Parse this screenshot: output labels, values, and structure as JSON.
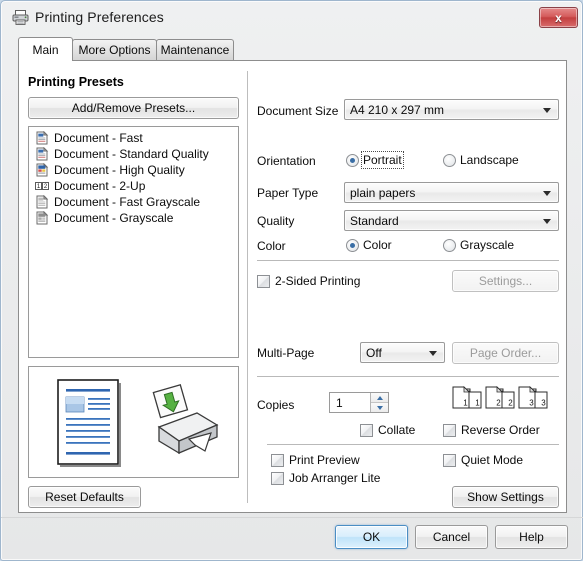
{
  "window": {
    "title": "Printing Preferences",
    "icon": "printer-icon",
    "close_label": "x"
  },
  "tabs": [
    {
      "label": "Main",
      "active": true
    },
    {
      "label": "More Options",
      "active": false
    },
    {
      "label": "Maintenance",
      "active": false
    }
  ],
  "presets": {
    "heading": "Printing Presets",
    "add_remove_label": "Add/Remove Presets...",
    "items": [
      {
        "label": "Document - Fast",
        "icon": "document-fast-icon"
      },
      {
        "label": "Document - Standard Quality",
        "icon": "document-standard-icon"
      },
      {
        "label": "Document - High Quality",
        "icon": "document-high-icon"
      },
      {
        "label": "Document - 2-Up",
        "icon": "document-2up-icon"
      },
      {
        "label": "Document - Fast Grayscale",
        "icon": "document-fast-grayscale-icon"
      },
      {
        "label": "Document - Grayscale",
        "icon": "document-grayscale-icon"
      }
    ]
  },
  "preview": {
    "document_icon": "document-page-preview-icon",
    "printer_icon": "printer-output-icon"
  },
  "settings": {
    "document_size": {
      "label": "Document Size",
      "value": "A4 210 x 297 mm"
    },
    "orientation": {
      "label": "Orientation",
      "portrait_label": "Portrait",
      "landscape_label": "Landscape",
      "selected": "Portrait"
    },
    "paper_type": {
      "label": "Paper Type",
      "value": "plain papers"
    },
    "quality": {
      "label": "Quality",
      "value": "Standard"
    },
    "color": {
      "label": "Color",
      "color_label": "Color",
      "grayscale_label": "Grayscale",
      "selected": "Color"
    },
    "two_sided": {
      "label": "2-Sided Printing",
      "checked": false,
      "settings_label": "Settings...",
      "settings_enabled": false
    },
    "multi_page": {
      "label": "Multi-Page",
      "value": "Off",
      "page_order_label": "Page Order...",
      "page_order_enabled": false
    },
    "copies": {
      "label": "Copies",
      "value": "1",
      "order_icons": [
        "1",
        "2",
        "3"
      ],
      "collate_label": "Collate",
      "collate_checked": false,
      "reverse_order_label": "Reverse Order",
      "reverse_order_checked": false
    },
    "print_preview": {
      "label": "Print Preview",
      "checked": false
    },
    "job_arranger": {
      "label": "Job Arranger Lite",
      "checked": false
    },
    "quiet_mode": {
      "label": "Quiet Mode",
      "checked": false
    }
  },
  "panel_buttons": {
    "reset_defaults": "Reset Defaults",
    "show_settings": "Show Settings"
  },
  "footer": {
    "ok": "OK",
    "cancel": "Cancel",
    "help": "Help"
  },
  "colors": {
    "accent": "#3a6ea5",
    "default_button_border": "#4b8ec4",
    "close_button": "#c33f3f",
    "panel_bg": "#ffffff",
    "window_bg": "#eaebec"
  }
}
